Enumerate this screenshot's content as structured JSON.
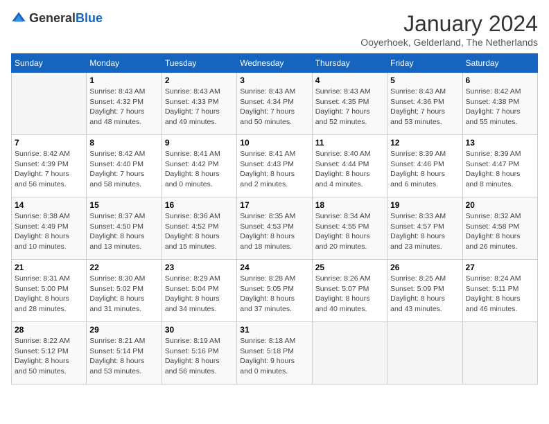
{
  "header": {
    "logo_general": "General",
    "logo_blue": "Blue",
    "month_title": "January 2024",
    "subtitle": "Ooyerhoek, Gelderland, The Netherlands"
  },
  "days_of_week": [
    "Sunday",
    "Monday",
    "Tuesday",
    "Wednesday",
    "Thursday",
    "Friday",
    "Saturday"
  ],
  "weeks": [
    [
      {
        "day": "",
        "info": ""
      },
      {
        "day": "1",
        "info": "Sunrise: 8:43 AM\nSunset: 4:32 PM\nDaylight: 7 hours\nand 48 minutes."
      },
      {
        "day": "2",
        "info": "Sunrise: 8:43 AM\nSunset: 4:33 PM\nDaylight: 7 hours\nand 49 minutes."
      },
      {
        "day": "3",
        "info": "Sunrise: 8:43 AM\nSunset: 4:34 PM\nDaylight: 7 hours\nand 50 minutes."
      },
      {
        "day": "4",
        "info": "Sunrise: 8:43 AM\nSunset: 4:35 PM\nDaylight: 7 hours\nand 52 minutes."
      },
      {
        "day": "5",
        "info": "Sunrise: 8:43 AM\nSunset: 4:36 PM\nDaylight: 7 hours\nand 53 minutes."
      },
      {
        "day": "6",
        "info": "Sunrise: 8:42 AM\nSunset: 4:38 PM\nDaylight: 7 hours\nand 55 minutes."
      }
    ],
    [
      {
        "day": "7",
        "info": "Sunrise: 8:42 AM\nSunset: 4:39 PM\nDaylight: 7 hours\nand 56 minutes."
      },
      {
        "day": "8",
        "info": "Sunrise: 8:42 AM\nSunset: 4:40 PM\nDaylight: 7 hours\nand 58 minutes."
      },
      {
        "day": "9",
        "info": "Sunrise: 8:41 AM\nSunset: 4:42 PM\nDaylight: 8 hours\nand 0 minutes."
      },
      {
        "day": "10",
        "info": "Sunrise: 8:41 AM\nSunset: 4:43 PM\nDaylight: 8 hours\nand 2 minutes."
      },
      {
        "day": "11",
        "info": "Sunrise: 8:40 AM\nSunset: 4:44 PM\nDaylight: 8 hours\nand 4 minutes."
      },
      {
        "day": "12",
        "info": "Sunrise: 8:39 AM\nSunset: 4:46 PM\nDaylight: 8 hours\nand 6 minutes."
      },
      {
        "day": "13",
        "info": "Sunrise: 8:39 AM\nSunset: 4:47 PM\nDaylight: 8 hours\nand 8 minutes."
      }
    ],
    [
      {
        "day": "14",
        "info": "Sunrise: 8:38 AM\nSunset: 4:49 PM\nDaylight: 8 hours\nand 10 minutes."
      },
      {
        "day": "15",
        "info": "Sunrise: 8:37 AM\nSunset: 4:50 PM\nDaylight: 8 hours\nand 13 minutes."
      },
      {
        "day": "16",
        "info": "Sunrise: 8:36 AM\nSunset: 4:52 PM\nDaylight: 8 hours\nand 15 minutes."
      },
      {
        "day": "17",
        "info": "Sunrise: 8:35 AM\nSunset: 4:53 PM\nDaylight: 8 hours\nand 18 minutes."
      },
      {
        "day": "18",
        "info": "Sunrise: 8:34 AM\nSunset: 4:55 PM\nDaylight: 8 hours\nand 20 minutes."
      },
      {
        "day": "19",
        "info": "Sunrise: 8:33 AM\nSunset: 4:57 PM\nDaylight: 8 hours\nand 23 minutes."
      },
      {
        "day": "20",
        "info": "Sunrise: 8:32 AM\nSunset: 4:58 PM\nDaylight: 8 hours\nand 26 minutes."
      }
    ],
    [
      {
        "day": "21",
        "info": "Sunrise: 8:31 AM\nSunset: 5:00 PM\nDaylight: 8 hours\nand 28 minutes."
      },
      {
        "day": "22",
        "info": "Sunrise: 8:30 AM\nSunset: 5:02 PM\nDaylight: 8 hours\nand 31 minutes."
      },
      {
        "day": "23",
        "info": "Sunrise: 8:29 AM\nSunset: 5:04 PM\nDaylight: 8 hours\nand 34 minutes."
      },
      {
        "day": "24",
        "info": "Sunrise: 8:28 AM\nSunset: 5:05 PM\nDaylight: 8 hours\nand 37 minutes."
      },
      {
        "day": "25",
        "info": "Sunrise: 8:26 AM\nSunset: 5:07 PM\nDaylight: 8 hours\nand 40 minutes."
      },
      {
        "day": "26",
        "info": "Sunrise: 8:25 AM\nSunset: 5:09 PM\nDaylight: 8 hours\nand 43 minutes."
      },
      {
        "day": "27",
        "info": "Sunrise: 8:24 AM\nSunset: 5:11 PM\nDaylight: 8 hours\nand 46 minutes."
      }
    ],
    [
      {
        "day": "28",
        "info": "Sunrise: 8:22 AM\nSunset: 5:12 PM\nDaylight: 8 hours\nand 50 minutes."
      },
      {
        "day": "29",
        "info": "Sunrise: 8:21 AM\nSunset: 5:14 PM\nDaylight: 8 hours\nand 53 minutes."
      },
      {
        "day": "30",
        "info": "Sunrise: 8:19 AM\nSunset: 5:16 PM\nDaylight: 8 hours\nand 56 minutes."
      },
      {
        "day": "31",
        "info": "Sunrise: 8:18 AM\nSunset: 5:18 PM\nDaylight: 9 hours\nand 0 minutes."
      },
      {
        "day": "",
        "info": ""
      },
      {
        "day": "",
        "info": ""
      },
      {
        "day": "",
        "info": ""
      }
    ]
  ]
}
